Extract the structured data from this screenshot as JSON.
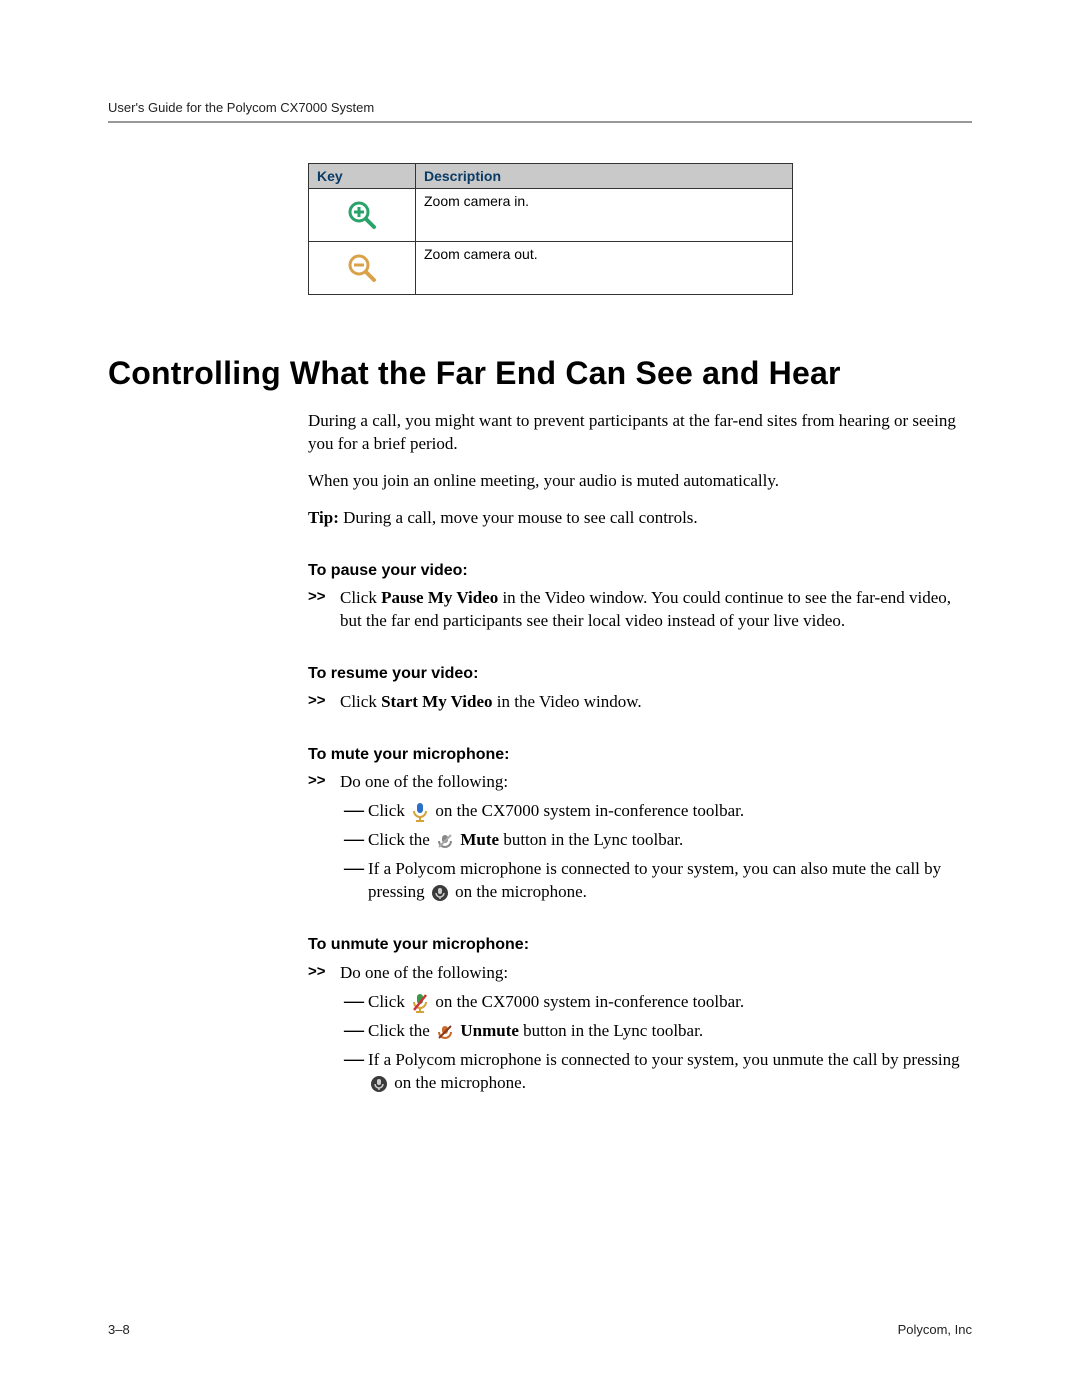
{
  "header": {
    "running_head": "User's Guide for the Polycom CX7000 System"
  },
  "table": {
    "head_key": "Key",
    "head_desc": "Description",
    "rows": [
      {
        "icon": "zoom-in-icon",
        "desc": "Zoom camera in."
      },
      {
        "icon": "zoom-out-icon",
        "desc": "Zoom camera out."
      }
    ]
  },
  "section": {
    "title": "Controlling What the Far End Can See and Hear",
    "intro_p1": "During a call, you might want to prevent participants at the far-end sites from hearing or seeing you for a brief period.",
    "intro_p2": "When you join an online meeting, your audio is muted automatically.",
    "tip_label": "Tip:",
    "tip_text": " During a call, move your mouse to see call controls.",
    "sub_pause": {
      "head": "To pause your video:",
      "marker": ">>",
      "line_pre": "Click ",
      "line_bold": "Pause My Video",
      "line_post": " in the Video window. You could continue to see the far-end video, but the far end participants see their local video instead of your live video."
    },
    "sub_resume": {
      "head": "To resume your video:",
      "marker": ">>",
      "line_pre": "Click ",
      "line_bold": "Start My Video",
      "line_post": " in the Video window."
    },
    "sub_mute": {
      "head": "To mute your microphone:",
      "marker": ">>",
      "line": "Do one of the following:",
      "dash": "—",
      "opt1_pre": "Click ",
      "opt1_post": " on the CX7000 system in-conference toolbar.",
      "opt2_pre": "Click the ",
      "opt2_bold": "Mute",
      "opt2_post": " button in the Lync toolbar.",
      "opt3_pre": "If a Polycom microphone is connected to your system, you can also mute the call by pressing ",
      "opt3_post": " on the microphone."
    },
    "sub_unmute": {
      "head": "To unmute your microphone:",
      "marker": ">>",
      "line": "Do one of the following:",
      "dash": "—",
      "opt1_pre": "Click ",
      "opt1_post": " on the CX7000 system in-conference toolbar.",
      "opt2_pre": "Click the ",
      "opt2_bold": "Unmute",
      "opt2_post": " button in the Lync toolbar.",
      "opt3_pre": "If a Polycom microphone is connected to your system, you unmute the call by pressing ",
      "opt3_post": " on the microphone."
    }
  },
  "footer": {
    "page_num": "3–8",
    "company": "Polycom, Inc"
  }
}
